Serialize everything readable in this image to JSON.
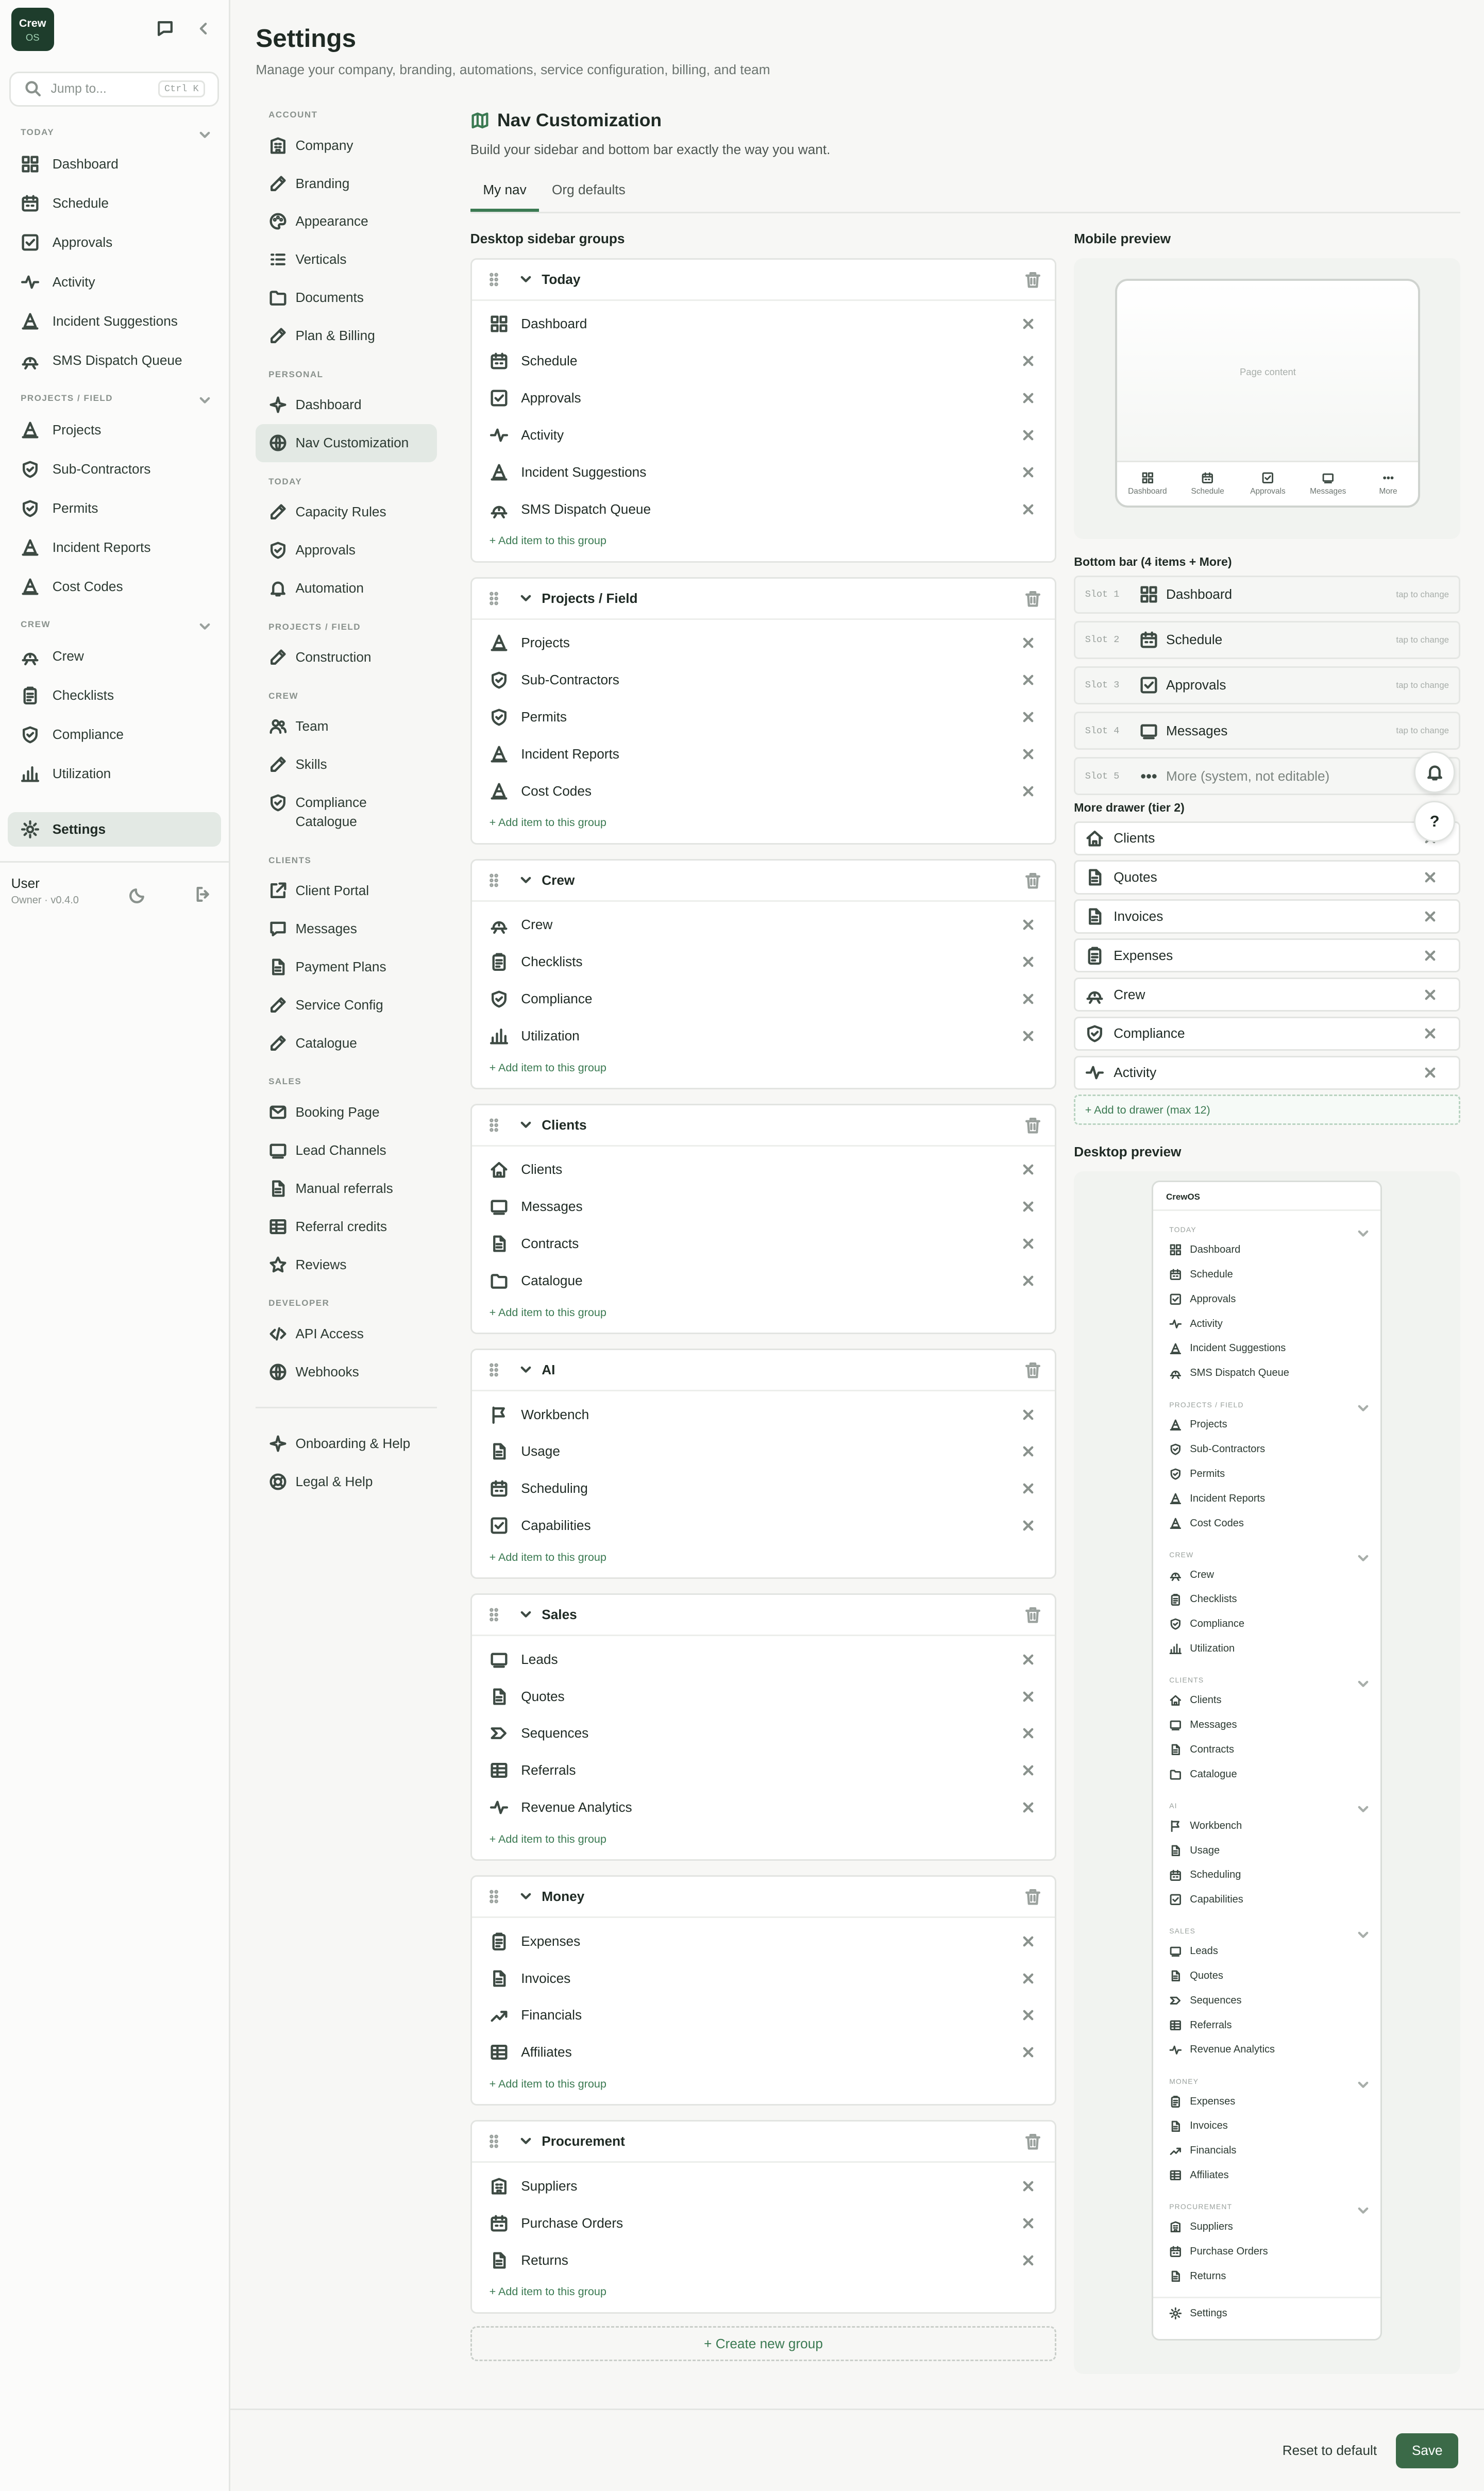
{
  "app": {
    "logo_line1": "Crew",
    "logo_line2": "OS"
  },
  "jump": {
    "placeholder": "Jump to...",
    "shortcut": "Ctrl K"
  },
  "sidebar": {
    "sections": [
      {
        "title": "TODAY",
        "items": [
          {
            "label": "Dashboard",
            "icon": "grid"
          },
          {
            "label": "Schedule",
            "icon": "calendar"
          },
          {
            "label": "Approvals",
            "icon": "check"
          },
          {
            "label": "Activity",
            "icon": "pulse"
          },
          {
            "label": "Incident Suggestions",
            "icon": "cone"
          },
          {
            "label": "SMS Dispatch Queue",
            "icon": "hat"
          }
        ]
      },
      {
        "title": "PROJECTS / FIELD",
        "items": [
          {
            "label": "Projects",
            "icon": "cone"
          },
          {
            "label": "Sub-Contractors",
            "icon": "shield"
          },
          {
            "label": "Permits",
            "icon": "shield"
          },
          {
            "label": "Incident Reports",
            "icon": "cone"
          },
          {
            "label": "Cost Codes",
            "icon": "cone"
          }
        ]
      },
      {
        "title": "CREW",
        "items": [
          {
            "label": "Crew",
            "icon": "hat"
          },
          {
            "label": "Checklists",
            "icon": "clipboard"
          },
          {
            "label": "Compliance",
            "icon": "shield"
          },
          {
            "label": "Utilization",
            "icon": "bars"
          }
        ]
      }
    ],
    "settings_label": "Settings",
    "user_name": "User",
    "user_role": "Owner · v0.4.0"
  },
  "page": {
    "title": "Settings",
    "subtitle": "Manage your company, branding, automations, service configuration, billing, and team"
  },
  "settings_nav": [
    {
      "title": "ACCOUNT",
      "items": [
        {
          "label": "Company",
          "icon": "building"
        },
        {
          "label": "Branding",
          "icon": "pen"
        },
        {
          "label": "Appearance",
          "icon": "palette"
        },
        {
          "label": "Verticals",
          "icon": "list"
        },
        {
          "label": "Documents",
          "icon": "folder"
        },
        {
          "label": "Plan & Billing",
          "icon": "pen"
        }
      ]
    },
    {
      "title": "PERSONAL",
      "items": [
        {
          "label": "Dashboard",
          "icon": "sparkle"
        },
        {
          "label": "Nav Customization",
          "icon": "globe",
          "active": true
        }
      ]
    },
    {
      "title": "TODAY",
      "items": [
        {
          "label": "Capacity Rules",
          "icon": "pen"
        },
        {
          "label": "Approvals",
          "icon": "shield"
        },
        {
          "label": "Automation",
          "icon": "bell"
        }
      ]
    },
    {
      "title": "PROJECTS / FIELD",
      "items": [
        {
          "label": "Construction",
          "icon": "pen"
        }
      ]
    },
    {
      "title": "CREW",
      "items": [
        {
          "label": "Team",
          "icon": "users"
        },
        {
          "label": "Skills",
          "icon": "pen"
        },
        {
          "label": "Compliance Catalogue",
          "icon": "shield",
          "wrap": true
        }
      ]
    },
    {
      "title": "CLIENTS",
      "items": [
        {
          "label": "Client Portal",
          "icon": "external"
        },
        {
          "label": "Messages",
          "icon": "chat"
        },
        {
          "label": "Payment Plans",
          "icon": "doc"
        },
        {
          "label": "Service Config",
          "icon": "pen"
        },
        {
          "label": "Catalogue",
          "icon": "pen"
        }
      ]
    },
    {
      "title": "SALES",
      "items": [
        {
          "label": "Booking Page",
          "icon": "mail"
        },
        {
          "label": "Lead Channels",
          "icon": "inbox"
        },
        {
          "label": "Manual referrals",
          "icon": "doc"
        },
        {
          "label": "Referral credits",
          "icon": "table"
        },
        {
          "label": "Reviews",
          "icon": "star"
        }
      ]
    },
    {
      "title": "DEVELOPER",
      "items": [
        {
          "label": "API Access",
          "icon": "code"
        },
        {
          "label": "Webhooks",
          "icon": "globe"
        }
      ]
    }
  ],
  "settings_nav_footer": [
    {
      "label": "Onboarding & Help",
      "icon": "sparkle"
    },
    {
      "label": "Legal & Help",
      "icon": "lifebuoy"
    }
  ],
  "content": {
    "title": "Nav Customization",
    "subtitle": "Build your sidebar and bottom bar exactly the way you want.",
    "tabs": [
      "My nav",
      "Org defaults"
    ],
    "groups_label": "Desktop sidebar groups",
    "add_item_label": "+ Add item to this group",
    "create_group_label": "+ Create new group",
    "groups": [
      {
        "name": "Today",
        "items": [
          {
            "label": "Dashboard",
            "icon": "grid"
          },
          {
            "label": "Schedule",
            "icon": "calendar"
          },
          {
            "label": "Approvals",
            "icon": "check"
          },
          {
            "label": "Activity",
            "icon": "pulse"
          },
          {
            "label": "Incident Suggestions",
            "icon": "cone"
          },
          {
            "label": "SMS Dispatch Queue",
            "icon": "hat"
          }
        ]
      },
      {
        "name": "Projects / Field",
        "items": [
          {
            "label": "Projects",
            "icon": "cone"
          },
          {
            "label": "Sub-Contractors",
            "icon": "shield"
          },
          {
            "label": "Permits",
            "icon": "shield"
          },
          {
            "label": "Incident Reports",
            "icon": "cone"
          },
          {
            "label": "Cost Codes",
            "icon": "cone"
          }
        ]
      },
      {
        "name": "Crew",
        "items": [
          {
            "label": "Crew",
            "icon": "hat"
          },
          {
            "label": "Checklists",
            "icon": "clipboard"
          },
          {
            "label": "Compliance",
            "icon": "shield"
          },
          {
            "label": "Utilization",
            "icon": "bars"
          }
        ]
      },
      {
        "name": "Clients",
        "items": [
          {
            "label": "Clients",
            "icon": "home"
          },
          {
            "label": "Messages",
            "icon": "inbox"
          },
          {
            "label": "Contracts",
            "icon": "doc"
          },
          {
            "label": "Catalogue",
            "icon": "folder"
          }
        ]
      },
      {
        "name": "AI",
        "items": [
          {
            "label": "Workbench",
            "icon": "flag"
          },
          {
            "label": "Usage",
            "icon": "doc"
          },
          {
            "label": "Scheduling",
            "icon": "calendar"
          },
          {
            "label": "Capabilities",
            "icon": "check"
          }
        ]
      },
      {
        "name": "Sales",
        "items": [
          {
            "label": "Leads",
            "icon": "inbox"
          },
          {
            "label": "Quotes",
            "icon": "doc"
          },
          {
            "label": "Sequences",
            "icon": "arrow"
          },
          {
            "label": "Referrals",
            "icon": "table"
          },
          {
            "label": "Revenue Analytics",
            "icon": "pulse"
          }
        ]
      },
      {
        "name": "Money",
        "items": [
          {
            "label": "Expenses",
            "icon": "clipboard"
          },
          {
            "label": "Invoices",
            "icon": "doc"
          },
          {
            "label": "Financials",
            "icon": "trend"
          },
          {
            "label": "Affiliates",
            "icon": "table"
          }
        ]
      },
      {
        "name": "Procurement",
        "items": [
          {
            "label": "Suppliers",
            "icon": "building"
          },
          {
            "label": "Purchase Orders",
            "icon": "calendar"
          },
          {
            "label": "Returns",
            "icon": "doc"
          }
        ]
      }
    ]
  },
  "mobile": {
    "label": "Mobile preview",
    "page_content": "Page content",
    "bottom_items": [
      {
        "label": "Dashboard",
        "icon": "grid"
      },
      {
        "label": "Schedule",
        "icon": "calendar"
      },
      {
        "label": "Approvals",
        "icon": "check"
      },
      {
        "label": "Messages",
        "icon": "inbox"
      },
      {
        "label": "More",
        "icon": "dots"
      }
    ],
    "bottom_bar_label": "Bottom bar (4 items + More)",
    "slots": [
      {
        "slot": "Slot 1",
        "label": "Dashboard",
        "icon": "grid",
        "hint": "tap to change"
      },
      {
        "slot": "Slot 2",
        "label": "Schedule",
        "icon": "calendar",
        "hint": "tap to change"
      },
      {
        "slot": "Slot 3",
        "label": "Approvals",
        "icon": "check",
        "hint": "tap to change"
      },
      {
        "slot": "Slot 4",
        "label": "Messages",
        "icon": "inbox",
        "hint": "tap to change"
      },
      {
        "slot": "Slot 5",
        "label": "More (system, not editable)",
        "icon": "dots",
        "hint": ""
      }
    ],
    "drawer_label": "More drawer (tier 2)",
    "drawer_items": [
      {
        "label": "Clients",
        "icon": "home"
      },
      {
        "label": "Quotes",
        "icon": "doc"
      },
      {
        "label": "Invoices",
        "icon": "doc"
      },
      {
        "label": "Expenses",
        "icon": "clipboard"
      },
      {
        "label": "Crew",
        "icon": "hat"
      },
      {
        "label": "Compliance",
        "icon": "shield"
      },
      {
        "label": "Activity",
        "icon": "pulse"
      }
    ],
    "add_drawer_label": "+ Add to drawer (max 12)",
    "fab_help": "?"
  },
  "desktop_preview": {
    "label": "Desktop preview",
    "brand": "CrewOS",
    "settings_label": "Settings"
  },
  "footer": {
    "reset_label": "Reset to default",
    "save_label": "Save"
  },
  "colors": {
    "accent": "#3b7a52",
    "brand_dark": "#1e3d2c",
    "save_button": "#3b6a48"
  }
}
